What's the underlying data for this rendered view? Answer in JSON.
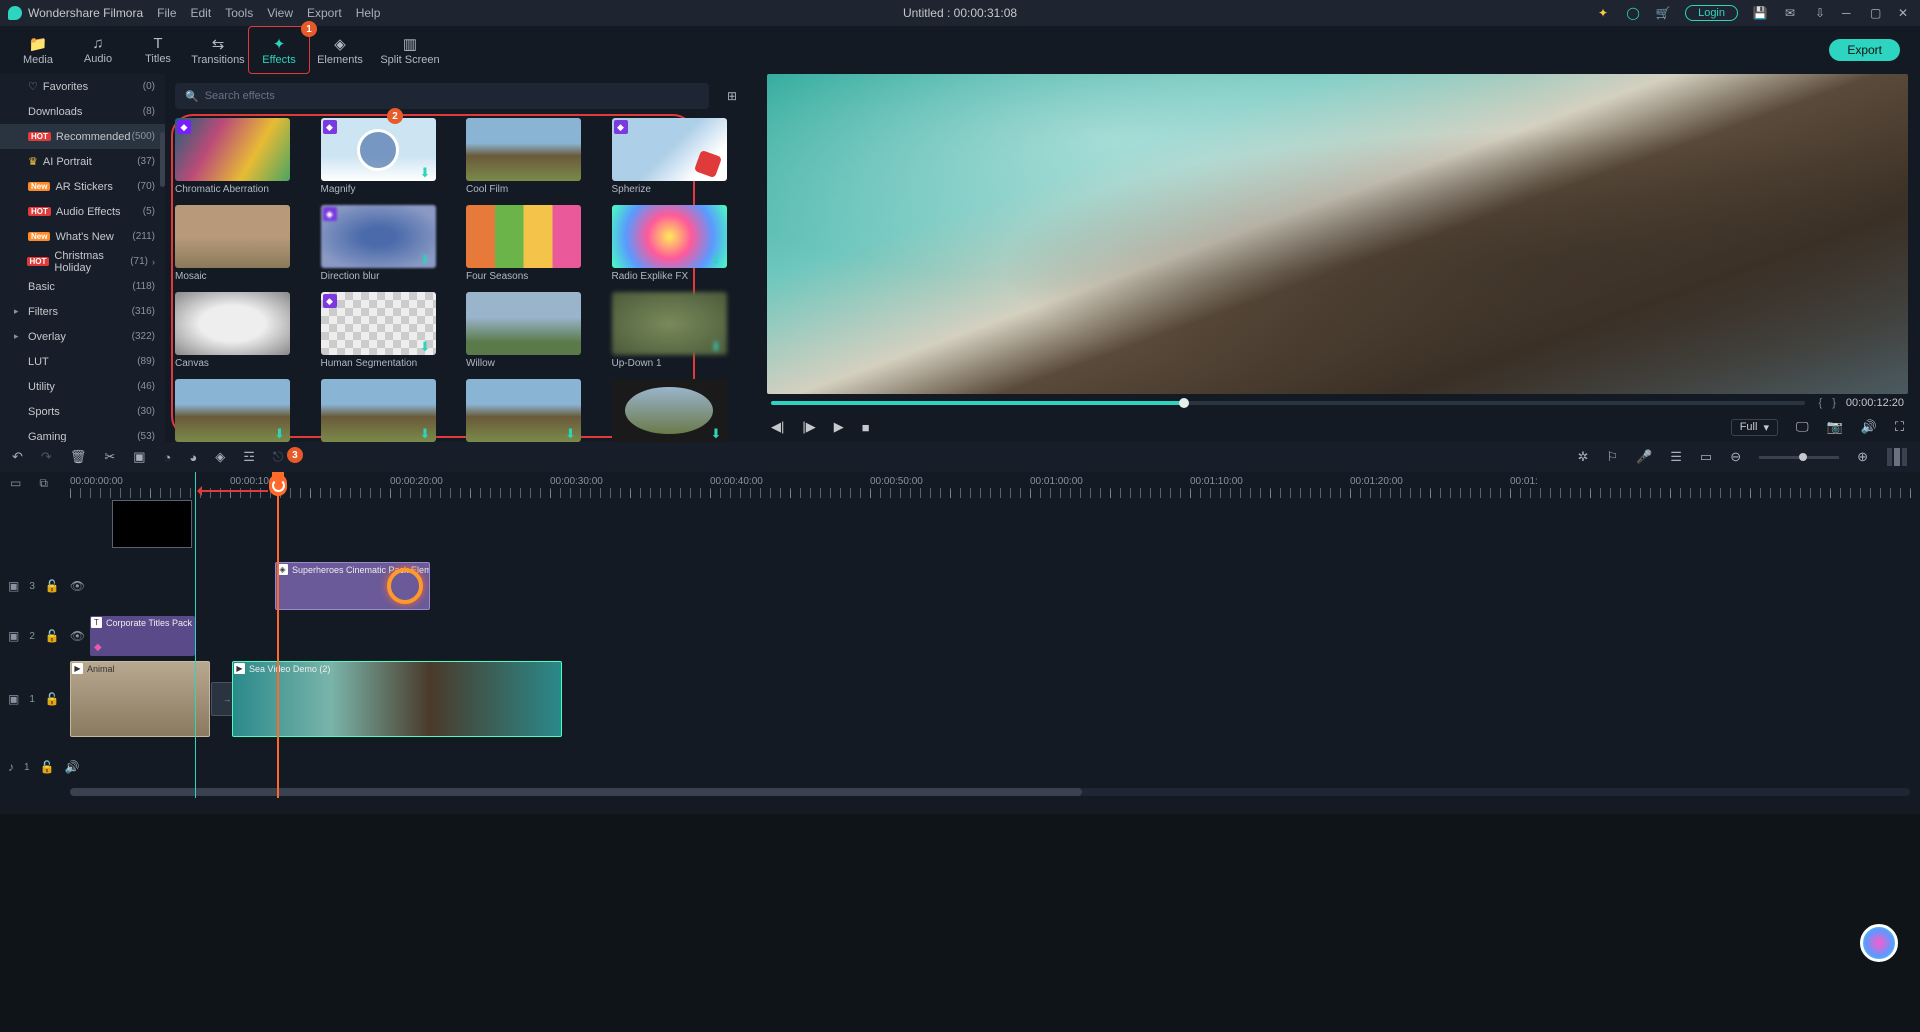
{
  "app_name": "Wondershare Filmora",
  "menu": [
    "File",
    "Edit",
    "Tools",
    "View",
    "Export",
    "Help"
  ],
  "doc_title": "Untitled : 00:00:31:08",
  "login_label": "Login",
  "tabs": [
    {
      "icon": "folder",
      "label": "Media"
    },
    {
      "icon": "music",
      "label": "Audio"
    },
    {
      "icon": "text",
      "label": "Titles"
    },
    {
      "icon": "swap",
      "label": "Transitions"
    },
    {
      "icon": "sparkle",
      "label": "Effects"
    },
    {
      "icon": "shapes",
      "label": "Elements"
    },
    {
      "icon": "split",
      "label": "Split Screen"
    }
  ],
  "export_label": "Export",
  "step_badges": {
    "effects": "1",
    "grid": "2",
    "speed": "3"
  },
  "sidebar": [
    {
      "icon": "heart",
      "label": "Favorites",
      "count": "(0)"
    },
    {
      "label": "Downloads",
      "count": "(8)"
    },
    {
      "tag": "HOT",
      "tagc": "hot",
      "label": "Recommended",
      "count": "(500)",
      "sel": true
    },
    {
      "crown": true,
      "label": "AI Portrait",
      "count": "(37)"
    },
    {
      "tag": "New",
      "tagc": "new",
      "label": "AR Stickers",
      "count": "(70)"
    },
    {
      "tag": "HOT",
      "tagc": "hot",
      "label": "Audio Effects",
      "count": "(5)"
    },
    {
      "tag": "New",
      "tagc": "new",
      "label": "What's New",
      "count": "(211)"
    },
    {
      "tag": "HOT",
      "tagc": "hot",
      "label": "Christmas Holiday",
      "count": "(71)",
      "chev": true
    },
    {
      "label": "Basic",
      "count": "(118)"
    },
    {
      "arrow": true,
      "label": "Filters",
      "count": "(316)"
    },
    {
      "arrow": true,
      "label": "Overlay",
      "count": "(322)"
    },
    {
      "label": "LUT",
      "count": "(89)"
    },
    {
      "label": "Utility",
      "count": "(46)"
    },
    {
      "label": "Sports",
      "count": "(30)"
    },
    {
      "label": "Gaming",
      "count": "(53)"
    }
  ],
  "search_placeholder": "Search effects",
  "effects": [
    {
      "label": "Chromatic Aberration",
      "bg": "bg-chrom",
      "gem": true
    },
    {
      "label": "Magnify",
      "bg": "bg-snow",
      "gem": true,
      "dl": true
    },
    {
      "label": "Cool Film",
      "bg": "bg-vine"
    },
    {
      "label": "Spherize",
      "bg": "bg-snow2",
      "gem": true
    },
    {
      "label": "Mosaic",
      "bg": "bg-sand"
    },
    {
      "label": "Direction blur",
      "bg": "bg-blur",
      "gem": true,
      "dl": true
    },
    {
      "label": "Four Seasons",
      "bg": "bg-4s"
    },
    {
      "label": "Radio Explike FX",
      "bg": "bg-radio",
      "dl": true
    },
    {
      "label": "Canvas",
      "bg": "bg-canvas"
    },
    {
      "label": "Human Segmentation",
      "bg": "bg-seg",
      "gem": true,
      "dl": true
    },
    {
      "label": "Willow",
      "bg": "bg-willow"
    },
    {
      "label": "Up-Down 1",
      "bg": "bg-updown",
      "dl": true
    },
    {
      "label": "",
      "bg": "bg-vine",
      "dl": true
    },
    {
      "label": "",
      "bg": "bg-vine",
      "dl": true
    },
    {
      "label": "",
      "bg": "bg-vine",
      "dl": true
    },
    {
      "label": "",
      "bg": "bg-oval",
      "dl": true
    }
  ],
  "preview": {
    "mark_open": "{",
    "mark_close": "}",
    "timecode": "00:00:12:20",
    "quality": "Full"
  },
  "ruler": [
    "00:00:00:00",
    "00:00:10:00",
    "00:00:20:00",
    "00:00:30:00",
    "00:00:40:00",
    "00:00:50:00",
    "00:01:00:00",
    "00:01:10:00",
    "00:01:20:00",
    "00:01:"
  ],
  "tracks": {
    "t3_label": "3",
    "t2_label": "2",
    "t1_label": "1",
    "a1_label": "1",
    "element_clip": "Superheroes Cinematic Pack Element",
    "titles_clip": "Corporate Titles Pack",
    "animal_clip": "Animal",
    "sea_clip": "Sea Video Demo (2)"
  }
}
